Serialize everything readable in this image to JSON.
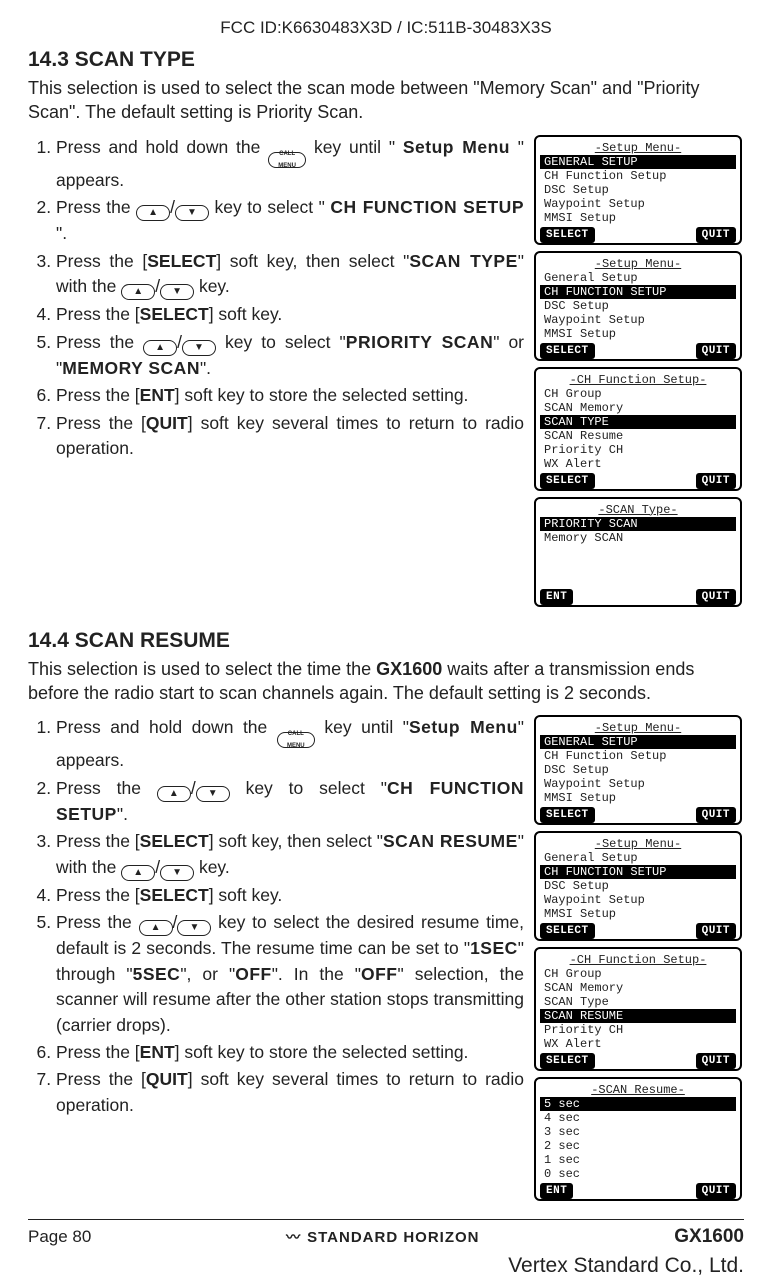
{
  "header": {
    "fcc": "FCC ID:K6630483X3D / IC:511B-30483X3S"
  },
  "sec143": {
    "heading": "14.3   SCAN TYPE",
    "intro": "This selection is used to select the scan mode between \"Memory Scan\" and \"Priority Scan\".  The default setting is Priority Scan.",
    "steps": {
      "s1a": "Press and hold down the ",
      "s1b": " key until \"",
      "s1c": "Setup Menu",
      "s1d": "\" appears.",
      "s2a": "Press the ",
      "s2b": " key to select \"",
      "s2c": "CH FUNCTION SETUP",
      "s2d": "\".",
      "s3a": "Press the [",
      "s3b": "SELECT",
      "s3c": "] soft key, then select \"",
      "s3d": "SCAN TYPE",
      "s3e": "\" with the ",
      "s3f": " key.",
      "s4a": "Press the [",
      "s4b": "SELECT",
      "s4c": "] soft key.",
      "s5a": "Press the ",
      "s5b": " key to select \"",
      "s5c": "PRIORITY SCAN",
      "s5d": "\" or \"",
      "s5e": "MEMORY SCAN",
      "s5f": "\".",
      "s6a": "Press the [",
      "s6b": "ENT",
      "s6c": "] soft key to store the selected setting.",
      "s7a": "Press the [",
      "s7b": "QUIT",
      "s7c": "] soft key several times to return to radio operation."
    },
    "lcd1": {
      "title": "-Setup Menu-",
      "hl": "GENERAL SETUP",
      "l1": "CH Function Setup",
      "l2": "DSC Setup",
      "l3": "Waypoint Setup",
      "l4": "MMSI Setup",
      "left": "SELECT",
      "right": "QUIT"
    },
    "lcd2": {
      "title": "-Setup Menu-",
      "l0": "General Setup",
      "hl": "CH FUNCTION SETUP",
      "l1": "DSC Setup",
      "l2": "Waypoint Setup",
      "l3": "MMSI Setup",
      "left": "SELECT",
      "right": "QUIT"
    },
    "lcd3": {
      "title": "-CH Function Setup-",
      "l0": "CH Group",
      "l1": "SCAN Memory",
      "hl": "SCAN TYPE",
      "l2": "SCAN Resume",
      "l3": "Priority CH",
      "l4": "WX Alert",
      "left": "SELECT",
      "right": "QUIT"
    },
    "lcd4": {
      "title": "-SCAN Type-",
      "hl": "PRIORITY SCAN",
      "l1": "Memory SCAN",
      "left": "ENT",
      "right": "QUIT"
    }
  },
  "sec144": {
    "heading": "14.4   SCAN RESUME",
    "intro_a": "This selection is used to select the time the ",
    "intro_model": "GX1600",
    "intro_b": " waits after a transmission ends before the radio start to scan channels again. The default setting is 2 seconds.",
    "steps": {
      "s1a": "Press and hold down the ",
      "s1b": " key until \"",
      "s1c": "Setup Menu",
      "s1d": "\" appears.",
      "s2a": "Press the ",
      "s2b": " key to select \"",
      "s2c": "CH FUNCTION SETUP",
      "s2d": "\".",
      "s3a": "Press the [",
      "s3b": "SELECT",
      "s3c": "] soft key, then select \"",
      "s3d": "SCAN RESUME",
      "s3e": "\" with the ",
      "s3f": " key.",
      "s4a": "Press the [",
      "s4b": "SELECT",
      "s4c": "] soft key.",
      "s5a": "Press the ",
      "s5b": " key to select the desired resume time, default is 2 seconds. The resume time can be set to \"",
      "s5c": "1SEC",
      "s5d": "\" through \"",
      "s5e": "5SEC",
      "s5f": "\", or \"",
      "s5g": "OFF",
      "s5h": "\". In the \"",
      "s5i": "OFF",
      "s5j": "\" selection, the scanner will resume after the other station stops transmitting (carrier drops).",
      "s6a": "Press the [",
      "s6b": "ENT",
      "s6c": "] soft key to store the selected setting.",
      "s7a": "Press the [",
      "s7b": "QUIT",
      "s7c": "] soft key several times to return to radio operation."
    },
    "lcd1": {
      "title": "-Setup Menu-",
      "hl": "GENERAL SETUP",
      "l1": "CH Function Setup",
      "l2": "DSC Setup",
      "l3": "Waypoint Setup",
      "l4": "MMSI Setup",
      "left": "SELECT",
      "right": "QUIT"
    },
    "lcd2": {
      "title": "-Setup Menu-",
      "l0": "General Setup",
      "hl": "CH FUNCTION SETUP",
      "l1": "DSC Setup",
      "l2": "Waypoint Setup",
      "l3": "MMSI Setup",
      "left": "SELECT",
      "right": "QUIT"
    },
    "lcd3": {
      "title": "-CH Function Setup-",
      "l0": "CH Group",
      "l1": "SCAN Memory",
      "l2": "SCAN Type",
      "hl": "SCAN RESUME",
      "l3": "Priority CH",
      "l4": "WX Alert",
      "left": "SELECT",
      "right": "QUIT"
    },
    "lcd4": {
      "title": "-SCAN Resume-",
      "hl": "5 sec",
      "l1": "4 sec",
      "l2": "3 sec",
      "l3": "2 sec",
      "l4": "1 sec",
      "l5": "0 sec",
      "left": "ENT",
      "right": "QUIT"
    }
  },
  "footer": {
    "page": "Page 80",
    "brand": "STANDARD HORIZON",
    "model": "GX1600",
    "vertex": "Vertex Standard Co., Ltd."
  },
  "icons": {
    "call_top": "CALL",
    "call_bot": "MENU",
    "up": "▲",
    "down": "▼",
    "slash": "/"
  }
}
